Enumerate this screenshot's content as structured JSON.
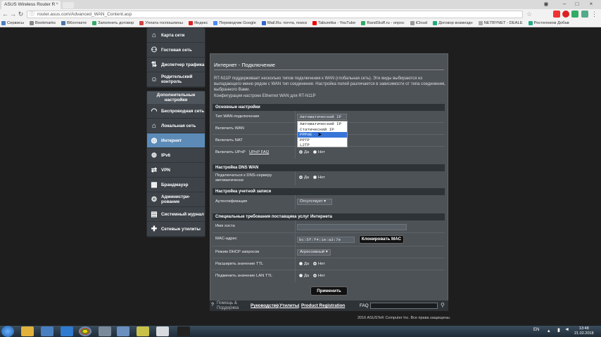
{
  "browser": {
    "tab_title": "ASUS Wireless Router R",
    "url": "router.asus.com/Advanced_WAN_Content.asp",
    "bookmarks": [
      "Сервисы",
      "Bookmarks",
      "ВКонтакте",
      "Заполнить договор",
      "Уплата госпошлины",
      "Яндекс",
      "Переводчик Google",
      "Mail.Ru: почта, поиск",
      "Taburetka - YouTube",
      "RandStuff.ru - опрос",
      "iCloud",
      "Договор возмездн",
      "NETBYNET - DEALE",
      "Ростелеком Добав"
    ]
  },
  "sidebar": {
    "items_top": [
      {
        "label": "Карта сети",
        "icon": "network-map-icon"
      },
      {
        "label": "Гостевая сеть",
        "icon": "guest-network-icon"
      },
      {
        "label": "Диспетчер трафика",
        "icon": "traffic-manager-icon"
      },
      {
        "label": "Родительский контроль",
        "icon": "parental-control-icon"
      }
    ],
    "advanced_header": "Дополнительные настройки",
    "items_adv": [
      {
        "label": "Беспроводная сеть",
        "icon": "wireless-icon"
      },
      {
        "label": "Локальная сеть",
        "icon": "lan-icon"
      },
      {
        "label": "Интернет",
        "icon": "globe-icon",
        "active": true
      },
      {
        "label": "IPv6",
        "icon": "ipv6-icon"
      },
      {
        "label": "VPN",
        "icon": "vpn-icon"
      },
      {
        "label": "Брандмауэр",
        "icon": "firewall-icon"
      },
      {
        "label": "Администри- рование",
        "icon": "admin-icon"
      },
      {
        "label": "Системный журнал",
        "icon": "system-log-icon"
      },
      {
        "label": "Сетевые утилиты",
        "icon": "network-tools-icon"
      }
    ]
  },
  "main": {
    "title": "Интернет - Подключение",
    "description": "RT-N11P поддерживает несколько типов подключения к WAN (глобальная сеть). Эти виды выбираются из выпадающего меню рядом с WAN тип соединения. Настройка полей различается в зависимости от типа соединения, выбранного Вами.",
    "config_note": "Конфигурация настроек Ethernet WAN для RT-N11P",
    "basic": {
      "header": "Основные настройки",
      "wan_type_label": "Тип WAN-подключения",
      "wan_type_value": "Автоматический IP",
      "enable_wan_label": "Включить WAN",
      "enable_nat_label": "Включить NAT",
      "enable_upnp_label": "Включить UPnP",
      "upnp_faq": "UPnP  FAQ",
      "yes": "Да",
      "no": "Нет"
    },
    "dropdown_options": [
      "Автоматический IP",
      "Статический IP",
      "PPPoE",
      "PPTP",
      "L2TP"
    ],
    "dns": {
      "header": "Настройка DNS WAN",
      "auto_dns_label": "Подключаться к DNS-серверу автоматически"
    },
    "account": {
      "header": "Настройка учетной записи",
      "auth_label": "Аутентификация",
      "auth_value": "Отсутствует"
    },
    "isp": {
      "header": "Специальные требования поставщика услуг Интернета",
      "hostname_label": "Имя хоста",
      "mac_label": "MAC-адрес",
      "mac_value": "bc:5f:f4:1e:a3:7e",
      "clone_mac": "Клонировать MAC",
      "dhcp_label": "Режим DHCP запросов",
      "dhcp_value": "Агрессивный",
      "extend_ttl_label": "Расширить значение TTL",
      "spoof_ttl_label": "Подменить значение LAN TTL"
    },
    "apply": "Применить"
  },
  "footer": {
    "help": "Помощь & Поддержка",
    "manual": "Руководство",
    "utilities": "Утилиты",
    "product_reg": "Product Registration",
    "faq": "FAQ",
    "copyright": "2016 ASUSTeK Computer Inc. Все права защищены."
  },
  "taskbar": {
    "lang": "EN",
    "time": "13:48",
    "date": "21.02.2018"
  }
}
